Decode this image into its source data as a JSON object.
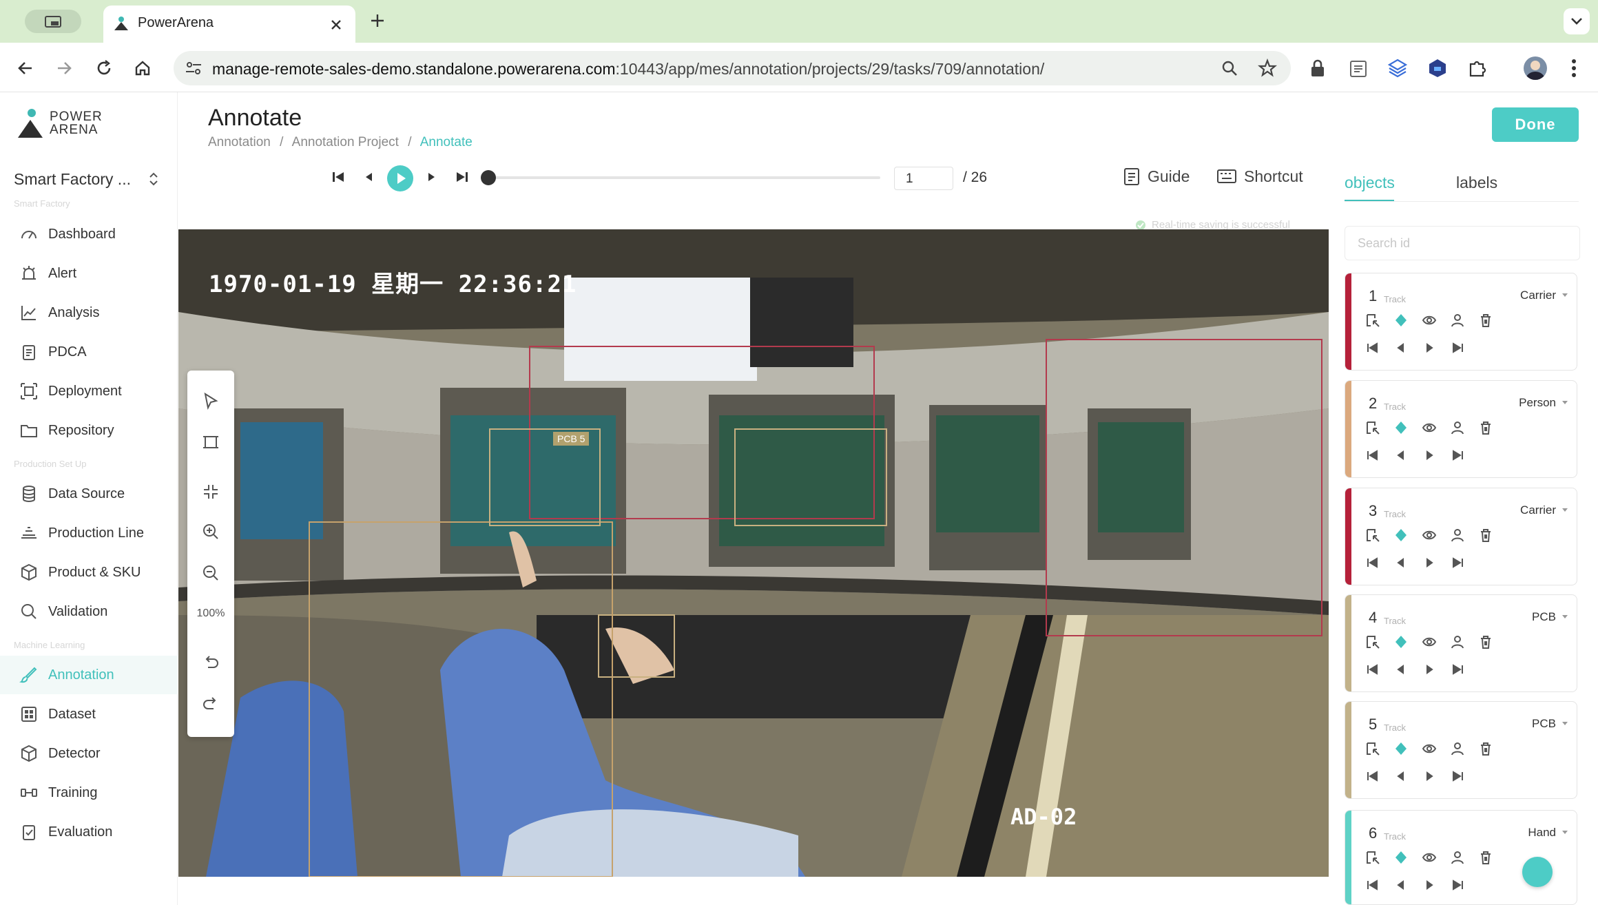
{
  "browser": {
    "tab_title": "PowerArena",
    "url_host": "manage-remote-sales-demo.standalone.powerarena.com",
    "url_rest": ":10443/app/mes/annotation/projects/29/tasks/709/annotation/"
  },
  "logo": {
    "line1": "POWER",
    "line2": "ARENA"
  },
  "workspace": {
    "name": "Smart Factory ..."
  },
  "sidebar": {
    "section1": "Smart Factory",
    "section2": "Production Set Up",
    "section3": "Machine Learning",
    "items": [
      {
        "label": "Dashboard"
      },
      {
        "label": "Alert"
      },
      {
        "label": "Analysis"
      },
      {
        "label": "PDCA"
      },
      {
        "label": "Deployment"
      },
      {
        "label": "Repository"
      },
      {
        "label": "Data Source"
      },
      {
        "label": "Production Line"
      },
      {
        "label": "Product & SKU"
      },
      {
        "label": "Validation"
      },
      {
        "label": "Annotation"
      },
      {
        "label": "Dataset"
      },
      {
        "label": "Detector"
      },
      {
        "label": "Training"
      },
      {
        "label": "Evaluation"
      }
    ]
  },
  "header": {
    "title": "Annotate",
    "breadcrumb": [
      "Annotation",
      "Annotation Project",
      "Annotate"
    ],
    "done": "Done"
  },
  "player": {
    "frame": "1",
    "total": "/ 26",
    "guide": "Guide",
    "shortcut": "Shortcut",
    "save_status": "Real-time saving is successful"
  },
  "video": {
    "timestamp": "1970-01-19 星期一 22:36:21",
    "camera": "AD-02",
    "box_label": "PCB 5"
  },
  "toolbar": {
    "zoom": "100%"
  },
  "panel": {
    "tabs": [
      "objects",
      "labels"
    ],
    "search_placeholder": "Search id",
    "track_word": "Track",
    "objects": [
      {
        "id": "1",
        "label": "Carrier",
        "color": "#b5213a"
      },
      {
        "id": "2",
        "label": "Person",
        "color": "#dba97e"
      },
      {
        "id": "3",
        "label": "Carrier",
        "color": "#b5213a"
      },
      {
        "id": "4",
        "label": "PCB",
        "color": "#c2b28a"
      },
      {
        "id": "5",
        "label": "PCB",
        "color": "#c2b28a"
      },
      {
        "id": "6",
        "label": "Hand",
        "color": "#5fd2c6"
      }
    ]
  },
  "colors": {
    "accent": "#41c0bb",
    "done": "#4dccc6"
  }
}
